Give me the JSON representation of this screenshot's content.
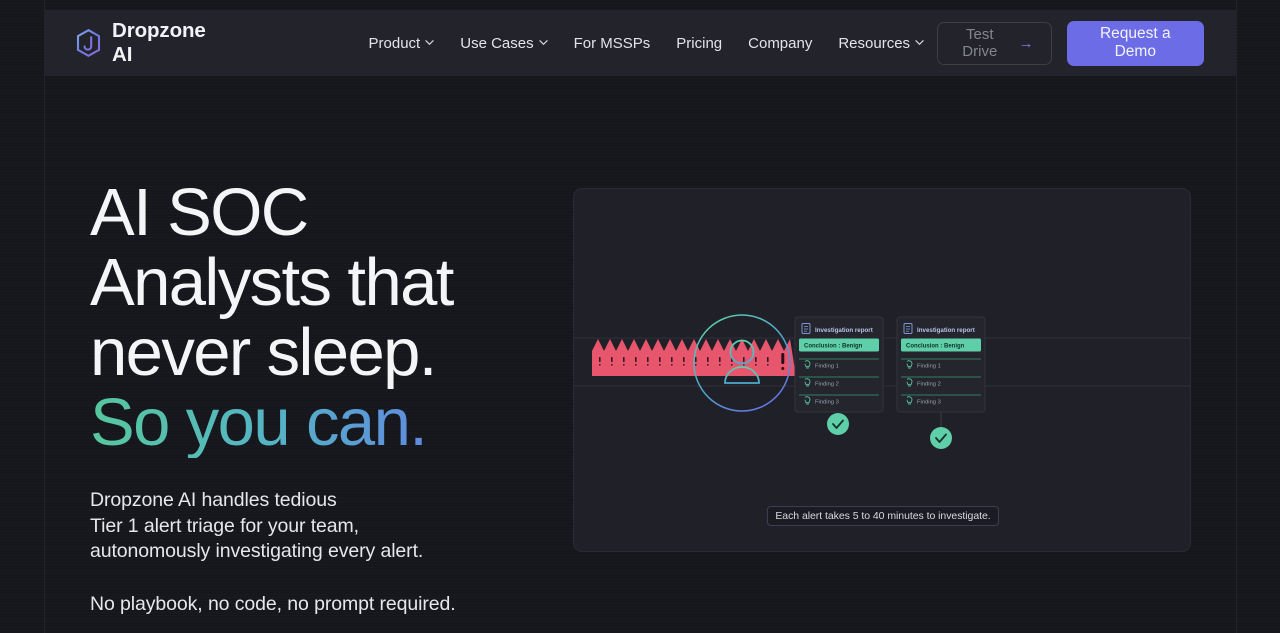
{
  "brand": {
    "name": "Dropzone AI",
    "logo_icon": "hexagon-logo-icon"
  },
  "nav": {
    "items": [
      {
        "label": "Product",
        "has_dropdown": true
      },
      {
        "label": "Use Cases",
        "has_dropdown": true
      },
      {
        "label": "For MSSPs",
        "has_dropdown": false
      },
      {
        "label": "Pricing",
        "has_dropdown": false
      },
      {
        "label": "Company",
        "has_dropdown": false
      },
      {
        "label": "Resources",
        "has_dropdown": true
      }
    ]
  },
  "actions": {
    "test_drive_label": "Test Drive",
    "test_drive_arrow": "→",
    "request_demo_label": "Request a Demo"
  },
  "hero": {
    "headline_line1": "AI SOC",
    "headline_line2": "Analysts that",
    "headline_line3": "never sleep.",
    "headline_line4_gradient": "So you can.",
    "sub_line1": "Dropzone AI handles tedious",
    "sub_line2": "Tier 1 alert triage for your team,",
    "sub_line3": "autonomously investigating every alert.",
    "sub2": "No playbook, no code, no prompt required."
  },
  "illustration": {
    "alert_stack_badge": "!",
    "caption": "Each alert takes 5 to 40 minutes to investigate.",
    "cards": [
      {
        "title": "Investigation report",
        "conclusion": "Conclusion : Benign",
        "findings": [
          "Finding 1",
          "Finding 2",
          "Finding 3"
        ]
      },
      {
        "title": "Investigation report",
        "conclusion": "Conclusion : Benign",
        "findings": [
          "Finding 1",
          "Finding 2",
          "Finding 3"
        ]
      }
    ]
  },
  "colors": {
    "page_bg": "#16171d",
    "header_bg": "#22232b",
    "accent_purple": "#6b6ce6",
    "accent_green": "#5ecfa8",
    "alert_red": "#e8566d",
    "panel_bg": "#202128"
  }
}
